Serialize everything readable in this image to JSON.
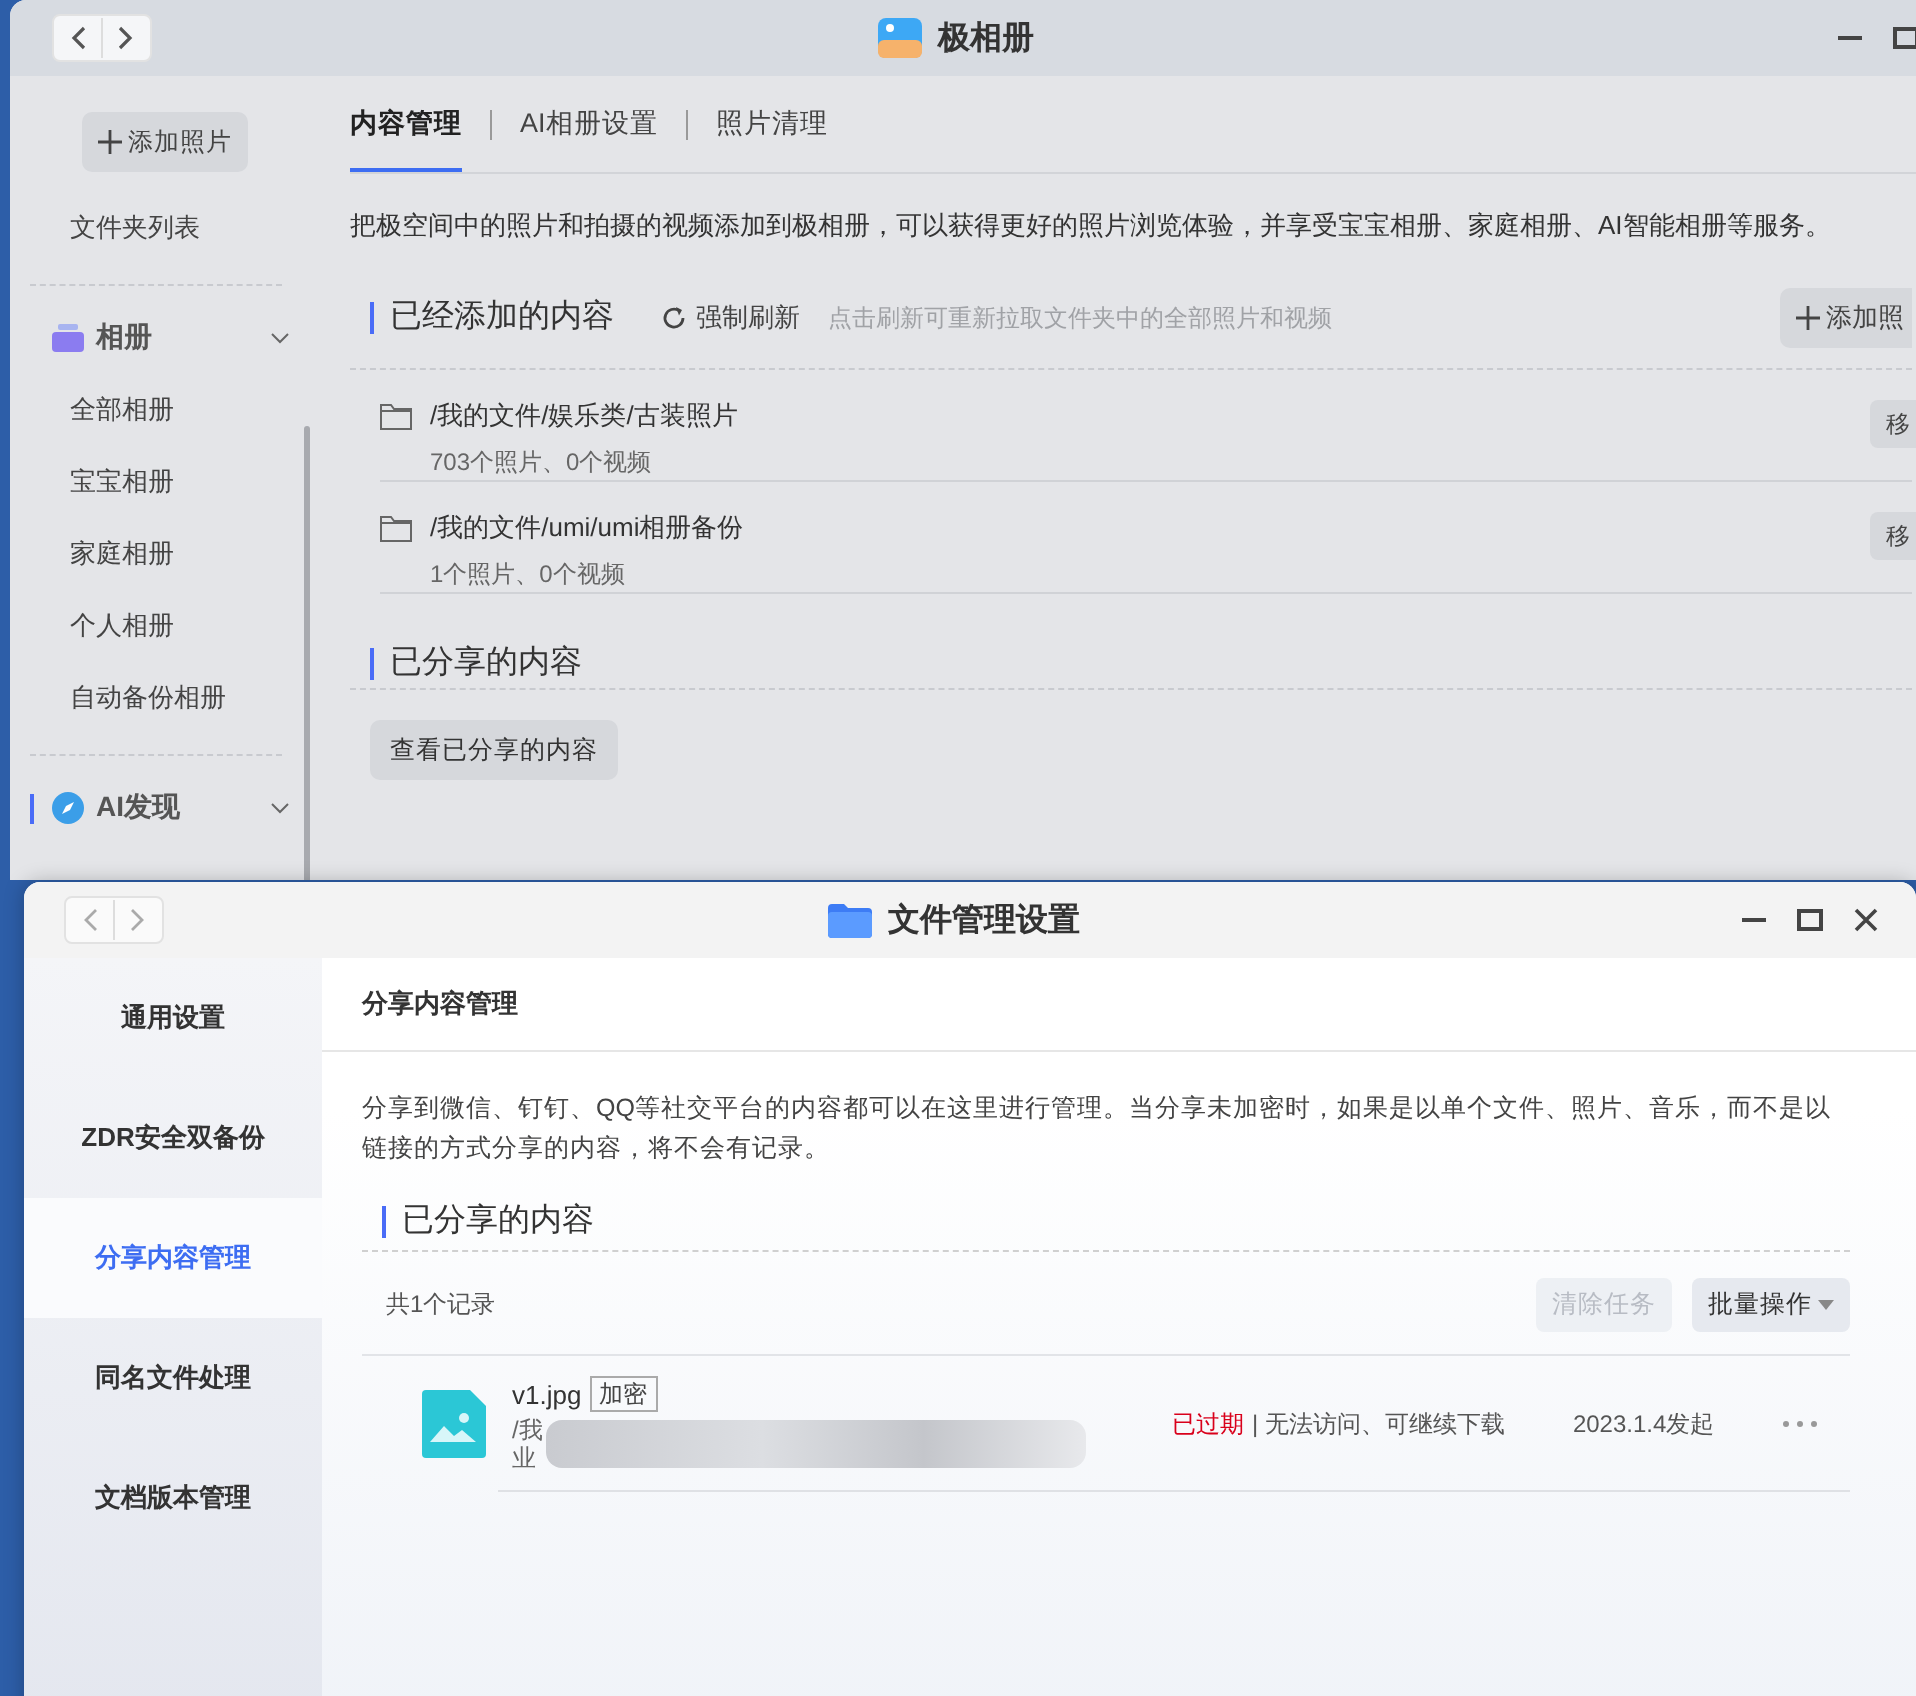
{
  "back_window": {
    "title": "极相册",
    "sidebar": {
      "add_button": "添加照片",
      "folder_list": "文件夹列表",
      "groups": [
        {
          "kind": "album",
          "label": "相册",
          "active": false,
          "items": [
            "全部相册",
            "宝宝相册",
            "家庭相册",
            "个人相册",
            "自动备份相册"
          ]
        },
        {
          "kind": "ai",
          "label": "AI发现",
          "active": true
        }
      ]
    },
    "tabs": [
      {
        "label": "内容管理",
        "selected": true
      },
      {
        "label": "AI相册设置",
        "selected": false
      },
      {
        "label": "照片清理",
        "selected": false
      }
    ],
    "description": "把极空间中的照片和拍摄的视频添加到极相册，可以获得更好的照片浏览体验，并享受宝宝相册、家庭相册、AI智能相册等服务。",
    "added": {
      "title": "已经添加的内容",
      "refresh": "强制刷新",
      "hint": "点击刷新可重新拉取文件夹中的全部照片和视频",
      "add_button": "添加照",
      "folders": [
        {
          "path": "/我的文件/娱乐类/古装照片",
          "counts": "703个照片、0个视频",
          "action": "移"
        },
        {
          "path": "/我的文件/umi/umi相册备份",
          "counts": "1个照片、0个视频",
          "action": "移"
        }
      ]
    },
    "shared": {
      "title": "已分享的内容",
      "button": "查看已分享的内容"
    }
  },
  "front_window": {
    "title": "文件管理设置",
    "sidebar": [
      {
        "label": "通用设置",
        "selected": false
      },
      {
        "label": "ZDR安全双备份",
        "selected": false
      },
      {
        "label": "分享内容管理",
        "selected": true
      },
      {
        "label": "同名文件处理",
        "selected": false
      },
      {
        "label": "文档版本管理",
        "selected": false
      }
    ],
    "header": "分享内容管理",
    "description": "分享到微信、钉钉、QQ等社交平台的内容都可以在这里进行管理。当分享未加密时，如果是以单个文件、照片、音乐，而不是以链接的方式分享的内容，将不会有记录。",
    "section_title": "已分享的内容",
    "record_count": "共1个记录",
    "buttons": [
      {
        "label": "清除任务",
        "disabled": true,
        "dropdown": false
      },
      {
        "label": "批量操作",
        "disabled": false,
        "dropdown": true
      }
    ],
    "records": [
      {
        "name": "v1.jpg",
        "badge": "加密",
        "path_start": "/我",
        "path_line2": "业",
        "status": {
          "kind": "expired",
          "label": "已过期"
        },
        "status_detail": "| 无法访问、可继续下载",
        "date": "2023.1.4发起"
      }
    ]
  }
}
